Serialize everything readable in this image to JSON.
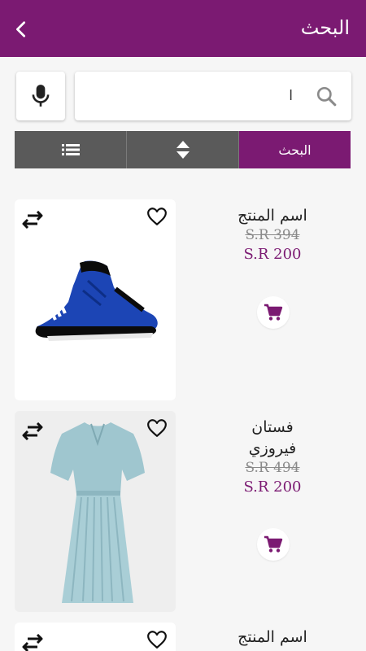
{
  "header": {
    "title": "البحث",
    "back_icon": "chevron-left-icon"
  },
  "search": {
    "query": "ا",
    "mic_icon": "mic-icon",
    "search_icon": "search-icon"
  },
  "toolbar": {
    "search_tab": "البحث",
    "sort_icon": "sort-icon",
    "list_icon": "list-icon"
  },
  "colors": {
    "primary": "#7b1a72",
    "toolbar_gray": "#5a5a5a"
  },
  "products": [
    {
      "name": "اسم المنتج",
      "old_price": "S.R 394",
      "price": "S.R 200",
      "image": "blue-sneaker"
    },
    {
      "name": "فستان فيروزي",
      "old_price": "S.R 494",
      "price": "S.R 200",
      "image": "light-blue-dress"
    },
    {
      "name": "اسم المنتج",
      "old_price": "",
      "price": "",
      "image": ""
    }
  ]
}
